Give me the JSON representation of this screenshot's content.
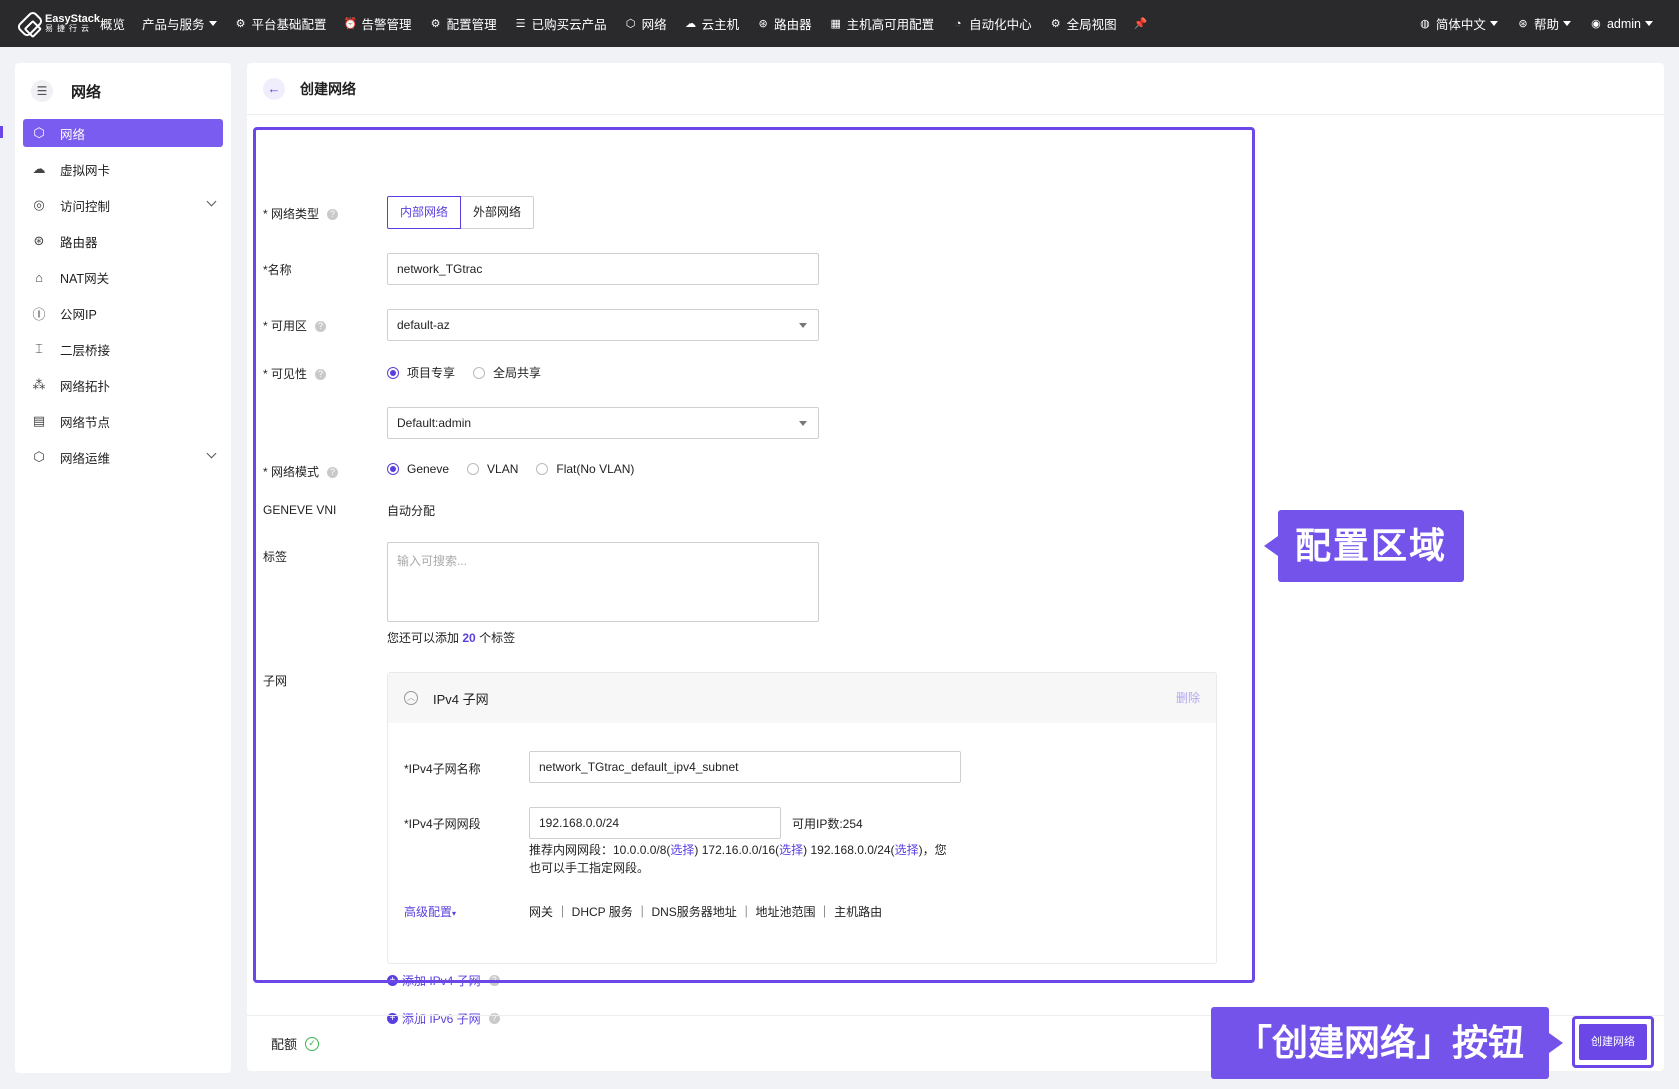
{
  "topbar": {
    "logo_text": "EasyStack",
    "logo_sub": "易捷行云",
    "nav": [
      "概览",
      "产品与服务",
      "平台基础配置",
      "告警管理",
      "配置管理",
      "已购买云产品",
      "网络",
      "云主机",
      "路由器",
      "主机高可用配置",
      "自动化中心",
      "全局视图"
    ],
    "language": "简体中文",
    "help": "帮助",
    "user": "admin"
  },
  "sidebar": {
    "title": "网络",
    "items": [
      {
        "label": "网络",
        "icon": "network-icon"
      },
      {
        "label": "虚拟网卡",
        "icon": "vnic-icon"
      },
      {
        "label": "访问控制",
        "icon": "access-icon"
      },
      {
        "label": "路由器",
        "icon": "router-icon"
      },
      {
        "label": "NAT网关",
        "icon": "nat-icon"
      },
      {
        "label": "公网IP",
        "icon": "ip-icon"
      },
      {
        "label": "二层桥接",
        "icon": "bridge-icon"
      },
      {
        "label": "网络拓扑",
        "icon": "topology-icon"
      },
      {
        "label": "网络节点",
        "icon": "node-icon"
      },
      {
        "label": "网络运维",
        "icon": "ops-icon"
      }
    ]
  },
  "page": {
    "title": "创建网络"
  },
  "form": {
    "network_type_label": "* 网络类型",
    "network_type_options": [
      "内部网络",
      "外部网络"
    ],
    "name_label": "*名称",
    "name_value": "network_TGtrac",
    "az_label": "* 可用区",
    "az_value": "default-az",
    "visibility_label": "* 可见性",
    "visibility_options": [
      "项目专享",
      "全局共享"
    ],
    "project_value": "Default:admin",
    "mode_label": "* 网络模式",
    "mode_options": [
      "Geneve",
      "VLAN",
      "Flat(No VLAN)"
    ],
    "vni_label": "GENEVE VNI",
    "vni_value": "自动分配",
    "tags_label": "标签",
    "tags_placeholder": "输入可搜索...",
    "tags_hint_prefix": "您还可以添加",
    "tags_hint_count": "20",
    "tags_hint_suffix": "个标签",
    "subnet_label": "子网"
  },
  "subnet": {
    "header": "IPv4 子网",
    "delete": "删除",
    "name_label": "*IPv4子网名称",
    "name_value": "network_TGtrac_default_ipv4_subnet",
    "cidr_label": "*IPv4子网网段",
    "cidr_value": "192.168.0.0/24",
    "available_ips": "可用IP数:254",
    "recommend_prefix": "推荐内网网段：10.0.0.0/8(",
    "select": "选择",
    "rec_2": ") 172.16.0.0/16(",
    "rec_3": ") 192.168.0.0/24(",
    "rec_end": ")，您",
    "recommend_line2": "也可以手工指定网段。",
    "advanced": "高级配置",
    "advanced_items": "网关 ｜ DHCP 服务 ｜ DNS服务器地址 ｜ 地址池范围 ｜ 主机路由"
  },
  "add_ipv4": "添加 IPv4 子网",
  "add_ipv6": "添加 IPv6 子网",
  "footer": {
    "quota": "配额",
    "create_button": "创建网络"
  },
  "annotations": {
    "config_area": "配置区域",
    "create_button_note": "「创建网络」按钮"
  },
  "colors": {
    "accent": "#6b47e8",
    "topbar": "#2a2a2c"
  }
}
